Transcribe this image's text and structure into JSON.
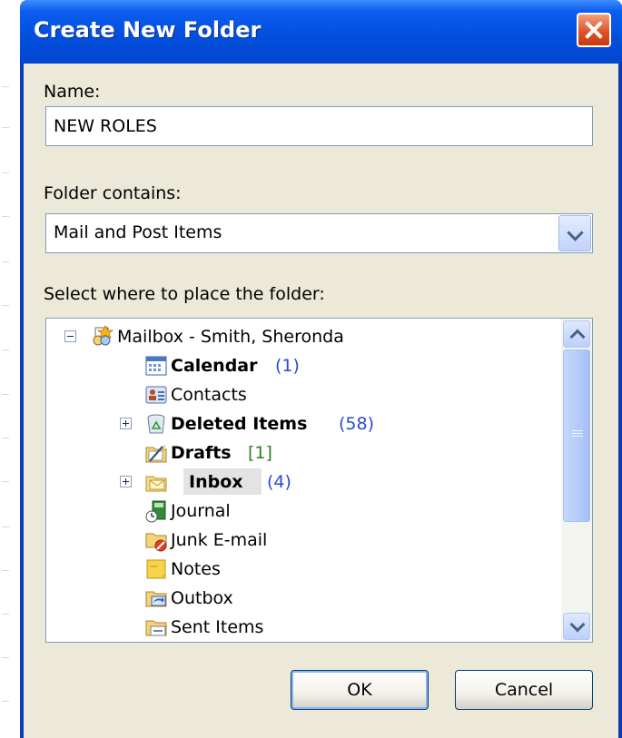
{
  "dialog": {
    "title": "Create New Folder",
    "name_label": "Name:",
    "name_value": "NEW ROLES",
    "contains_label": "Folder contains:",
    "contains_value": "Mail and Post Items",
    "place_label": "Select where to place the folder:",
    "ok_label": "OK",
    "cancel_label": "Cancel"
  },
  "tree": {
    "root": "Mailbox - Smith, Sheronda",
    "items": [
      {
        "label": "Calendar",
        "count": "(1)",
        "bold": true,
        "icon": "calendar-icon"
      },
      {
        "label": "Contacts",
        "count": "",
        "bold": false,
        "icon": "contacts-icon"
      },
      {
        "label": "Deleted Items",
        "count": "(58)",
        "bold": true,
        "icon": "trash-icon"
      },
      {
        "label": "Drafts",
        "count": "[1]",
        "bold": true,
        "icon": "drafts-icon"
      },
      {
        "label": "Inbox",
        "count": "(4)",
        "bold": true,
        "icon": "inbox-icon"
      },
      {
        "label": "Journal",
        "count": "",
        "bold": false,
        "icon": "journal-icon"
      },
      {
        "label": "Junk E-mail",
        "count": "",
        "bold": false,
        "icon": "junk-icon"
      },
      {
        "label": "Notes",
        "count": "",
        "bold": false,
        "icon": "notes-icon"
      },
      {
        "label": "Outbox",
        "count": "",
        "bold": false,
        "icon": "outbox-icon"
      },
      {
        "label": "Sent Items",
        "count": "",
        "bold": false,
        "icon": "sent-icon"
      }
    ]
  },
  "colors": {
    "title_bar": "#0350df",
    "close_button": "#e0542a",
    "dialog_face": "#ece9d8",
    "count_blue": "#2b49d3",
    "count_green": "#2e7d22"
  }
}
